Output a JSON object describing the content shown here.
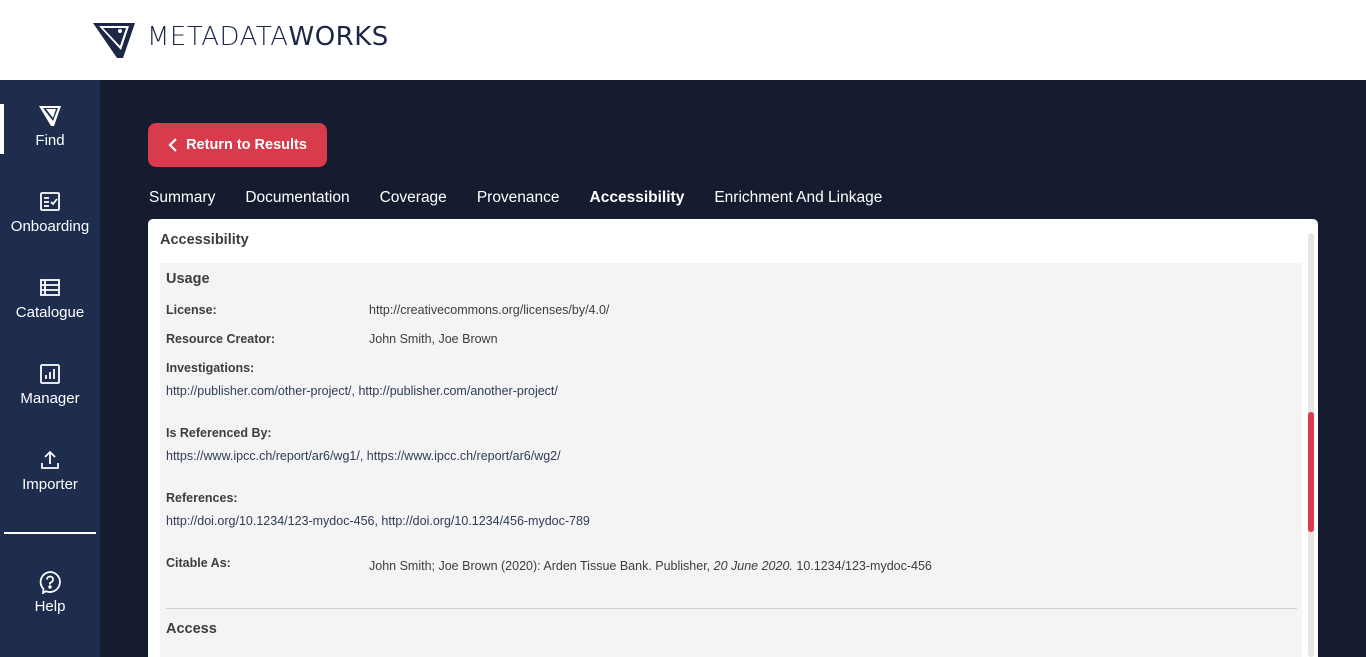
{
  "brand": {
    "name_light": "METADATA",
    "name_bold": "WORKS"
  },
  "sidebar": {
    "items": [
      {
        "label": "Find",
        "icon": "find-logo-icon"
      },
      {
        "label": "Onboarding",
        "icon": "checklist-icon"
      },
      {
        "label": "Catalogue",
        "icon": "list-icon"
      },
      {
        "label": "Manager",
        "icon": "bar-chart-icon"
      },
      {
        "label": "Importer",
        "icon": "upload-icon"
      },
      {
        "label": "Help",
        "icon": "help-icon"
      }
    ]
  },
  "main": {
    "return_label": "Return to Results",
    "tabs": [
      "Summary",
      "Documentation",
      "Coverage",
      "Provenance",
      "Accessibility",
      "Enrichment And Linkage"
    ],
    "active_tab": "Accessibility",
    "panel_title": "Accessibility",
    "usage": {
      "heading": "Usage",
      "license_label": "License:",
      "license_value": "http://creativecommons.org/licenses/by/4.0/",
      "creator_label": "Resource Creator:",
      "creator_value": "John Smith, Joe Brown",
      "investigations_label": "Investigations:",
      "investigations_value": "http://publisher.com/other-project/, http://publisher.com/another-project/",
      "referenced_by_label": "Is Referenced By:",
      "referenced_by_value": "https://www.ipcc.ch/report/ar6/wg1/, https://www.ipcc.ch/report/ar6/wg2/",
      "references_label": "References:",
      "references_value": "http://doi.org/10.1234/123-mydoc-456, http://doi.org/10.1234/456-mydoc-789",
      "citable_label": "Citable As:",
      "citable_prefix": "John Smith; Joe Brown (2020): Arden Tissue Bank. Publisher, ",
      "citable_date": "20 June 2020.",
      "citable_suffix": " 10.1234/123-mydoc-456"
    },
    "access": {
      "heading": "Access"
    }
  },
  "colors": {
    "accent": "#d83b4b",
    "sidebar_bg": "#1e2d4e",
    "main_bg": "#151c2f",
    "brand_text": "#1b2745"
  }
}
